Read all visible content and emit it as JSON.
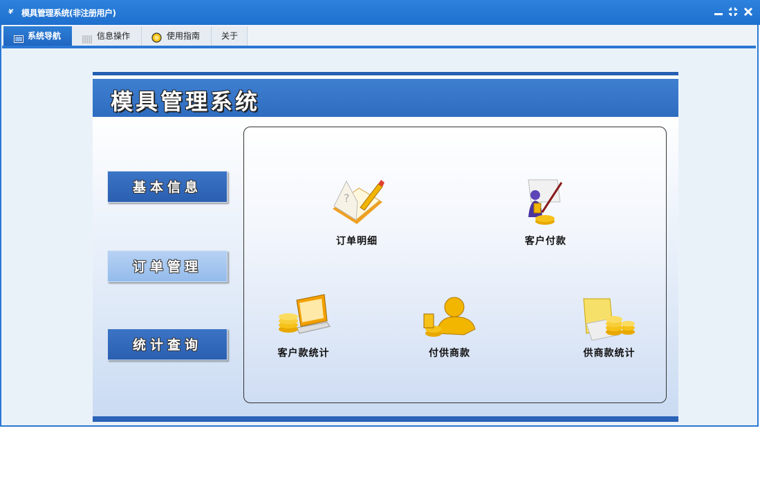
{
  "window": {
    "title": "模具管理系统(非注册用户)",
    "app_icon": "YF-logo-icon",
    "controls": [
      "minimize-icon",
      "restore-icon",
      "close-icon"
    ]
  },
  "tabs": [
    {
      "label": "系统导航",
      "icon": "monitor-icon",
      "active": true
    },
    {
      "label": "信息操作",
      "icon": "grid-icon",
      "active": false
    },
    {
      "label": "使用指南",
      "icon": "help-icon",
      "active": false
    },
    {
      "label": "关于",
      "icon": "",
      "active": false
    }
  ],
  "banner": {
    "title": "模具管理系统"
  },
  "sidebar": {
    "items": [
      {
        "label": "基本信息",
        "selected": false
      },
      {
        "label": "订单管理",
        "selected": true
      },
      {
        "label": "统计查询",
        "selected": false
      }
    ]
  },
  "content": {
    "items": [
      {
        "label": "订单明细",
        "icon": "notebook-pencil-icon"
      },
      {
        "label": "客户付款",
        "icon": "customer-payment-icon"
      },
      {
        "label": "客户款统计",
        "icon": "laptop-coins-icon"
      },
      {
        "label": "付供商款",
        "icon": "gold-person-icon"
      },
      {
        "label": "供商款统计",
        "icon": "coin-stacks-icon"
      }
    ]
  },
  "colors": {
    "titlebar": "#2a78d4",
    "banner": "#2e6cc0",
    "accent_gold": "#f2b500"
  }
}
